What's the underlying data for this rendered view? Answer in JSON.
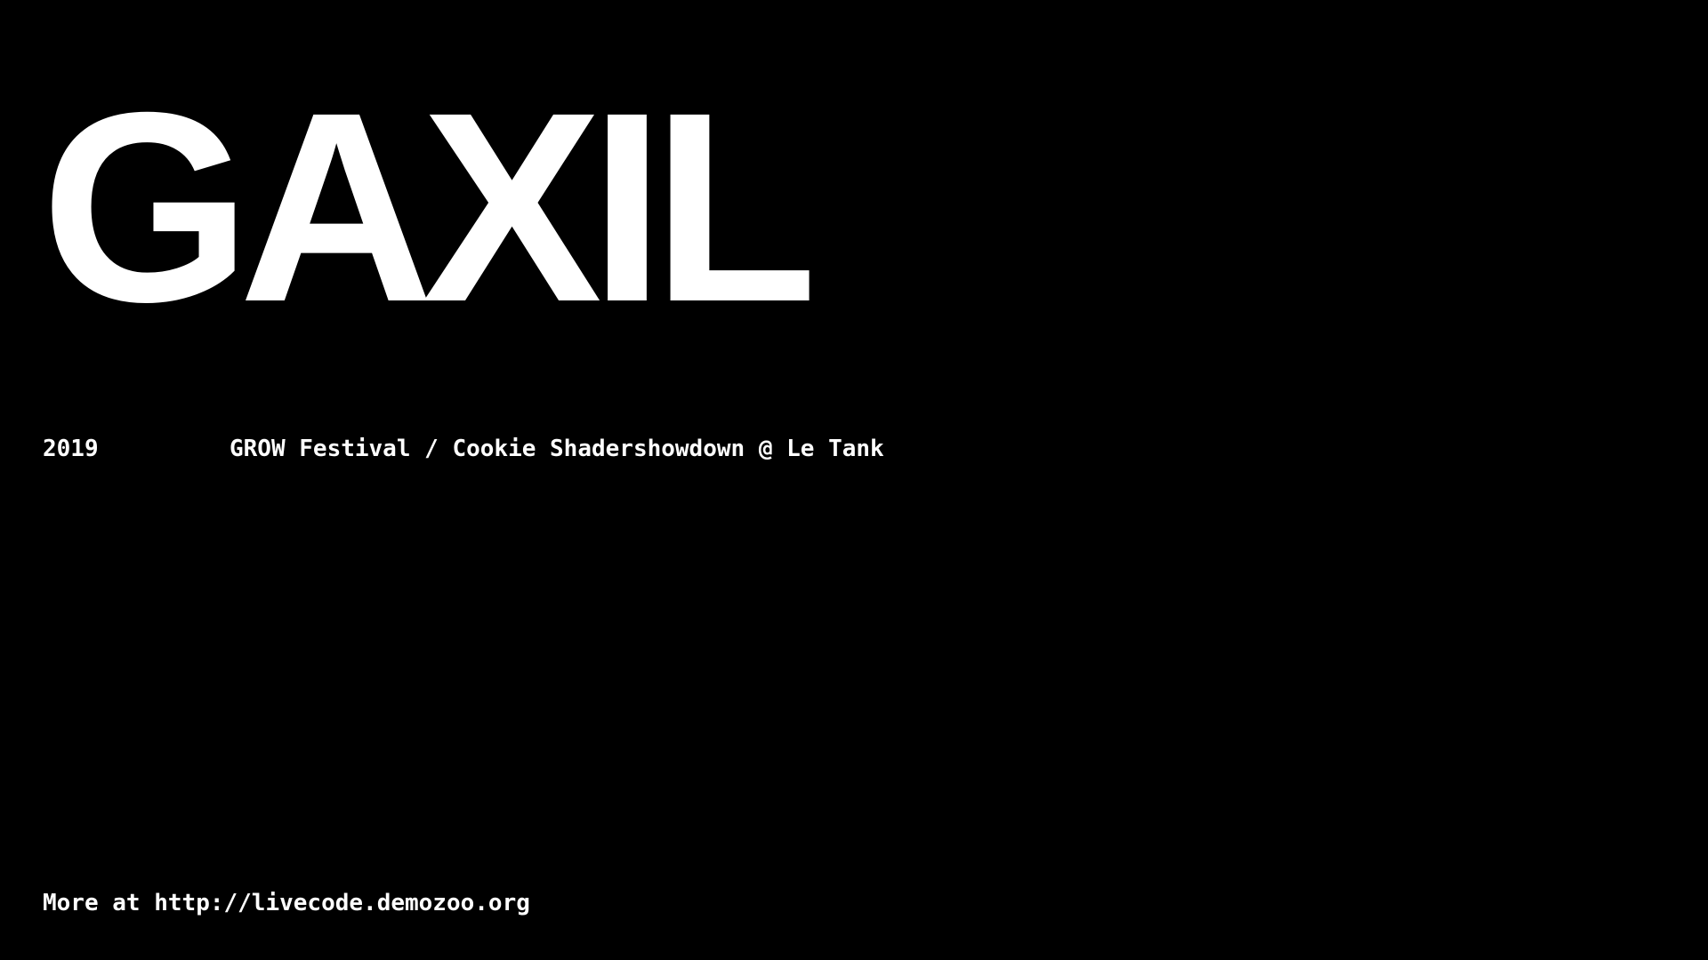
{
  "title": "GAXIL",
  "events": [
    {
      "year": "2019",
      "description": "GROW Festival / Cookie Shadershowdown @ Le Tank"
    }
  ],
  "footer": {
    "prefix": "More at",
    "link_text": "http://livecode.demozoo.org"
  },
  "colors": {
    "background": "#000000",
    "text": "#ffffff"
  }
}
